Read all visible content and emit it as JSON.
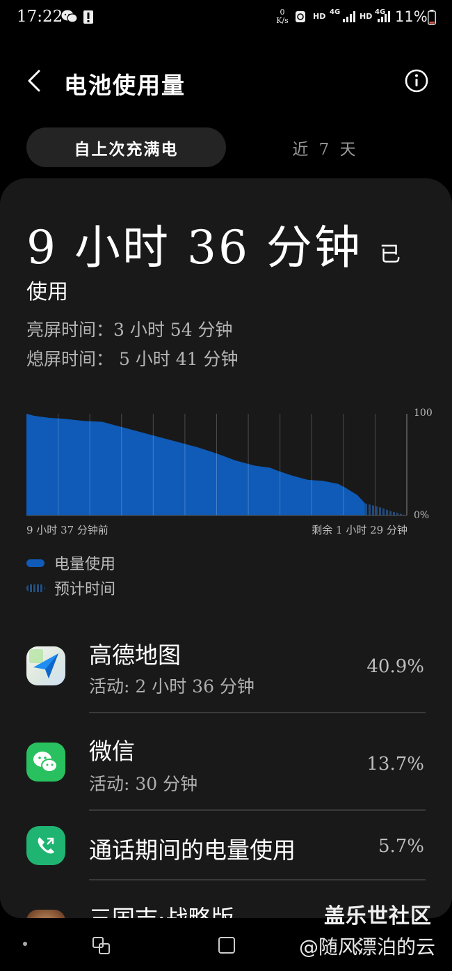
{
  "status_bar": {
    "time": "17:22",
    "net_speed_value": "0",
    "net_speed_unit": "K/s",
    "hd1": "HD",
    "net1": "4G",
    "hd2": "HD",
    "net2": "4G",
    "battery": "11%"
  },
  "header": {
    "title": "电池使用量"
  },
  "tabs": {
    "active": "自上次充满电",
    "inactive": "近 7 天"
  },
  "usage": {
    "total": "9 小时 36 分钟",
    "suffix_part1": "已",
    "suffix_part2": "使用",
    "screen_on": "亮屏时间：3 小时 54 分钟",
    "screen_off": "熄屏时间： 5 小时 41 分钟"
  },
  "chart_data": {
    "type": "area",
    "y_top_label": "100",
    "y_bottom_label": "0%",
    "x_start_label": "9 小时 37 分钟前",
    "x_end_label": "剩余 1 小时 29 分钟",
    "ylim": [
      0,
      100
    ],
    "actual_x": [
      0,
      0.02,
      0.06,
      0.1,
      0.15,
      0.2,
      0.22,
      0.27,
      0.32,
      0.36,
      0.4,
      0.45,
      0.5,
      0.55,
      0.6,
      0.64,
      0.66,
      0.7,
      0.74,
      0.78,
      0.82,
      0.84,
      0.87,
      0.89
    ],
    "actual_y": [
      100,
      98,
      96,
      95,
      93,
      92,
      90,
      85,
      80,
      76,
      72,
      67,
      61,
      54,
      49,
      47,
      44,
      39,
      35,
      34,
      31,
      27,
      20,
      12
    ],
    "projected_x": [
      0.89,
      0.93,
      0.96,
      1.0
    ],
    "projected_y": [
      12,
      8,
      4,
      0
    ],
    "grid_v": 12,
    "actual_color": "#0f5bb7",
    "projected_color": "#214a7e"
  },
  "legend": {
    "usage": "电量使用",
    "predicted": "预计时间"
  },
  "apps": [
    {
      "name": "高德地图",
      "sub": "活动: 2 小时 36 分钟",
      "pct": "40.9%",
      "icon": "amap-icon"
    },
    {
      "name": "微信",
      "sub": "活动: 30 分钟",
      "pct": "13.7%",
      "icon": "wechat-icon"
    },
    {
      "name": "通话期间的电量使用",
      "sub": "",
      "pct": "5.7%",
      "icon": "call-icon"
    },
    {
      "name": "三国志·战略版",
      "sub": "",
      "pct": "",
      "icon": "game-icon"
    }
  ],
  "watermark": {
    "line1": "盖乐世社区",
    "line2": "@随风漂泊的云"
  }
}
